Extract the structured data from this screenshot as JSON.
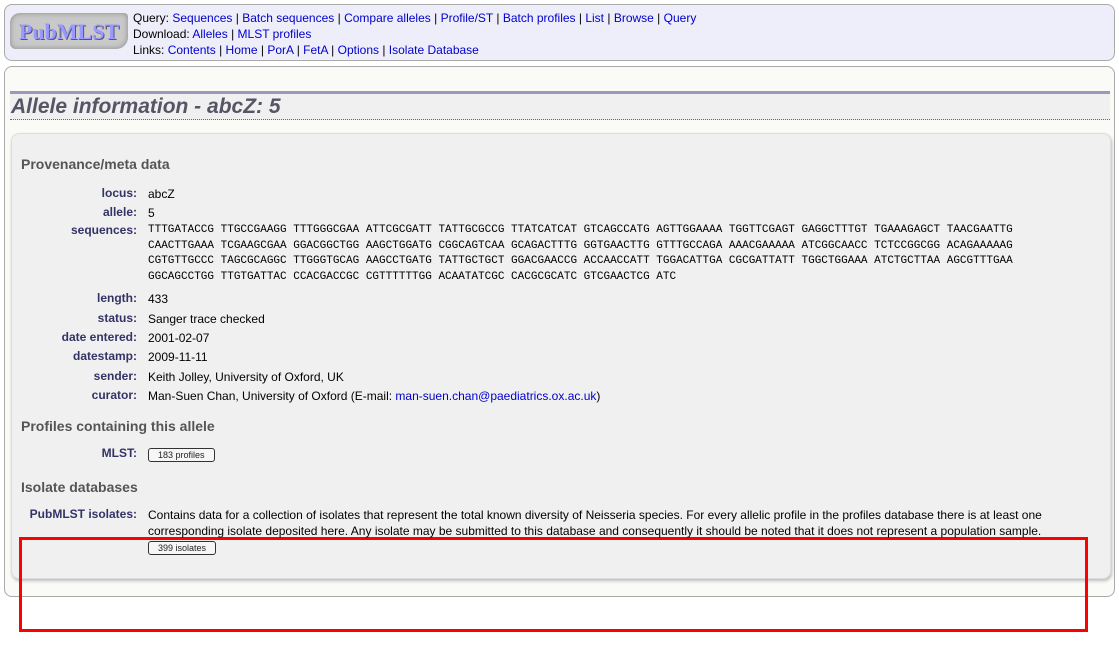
{
  "header": {
    "logo_text": "PubMLST",
    "query_label": "Query:",
    "query_links": [
      "Sequences",
      "Batch sequences",
      "Compare alleles",
      "Profile/ST",
      "Batch profiles",
      "List",
      "Browse",
      "Query"
    ],
    "download_label": "Download:",
    "download_links": [
      "Alleles",
      "MLST profiles"
    ],
    "links_label": "Links:",
    "links": [
      "Contents",
      "Home",
      "PorA",
      "FetA",
      "Options",
      "Isolate Database"
    ]
  },
  "title": "Allele information - abcZ: 5",
  "provenance": {
    "heading": "Provenance/meta data",
    "fields": [
      {
        "label": "locus:",
        "value": "abcZ"
      },
      {
        "label": "allele:",
        "value": "5"
      },
      {
        "label": "sequences:",
        "value": "TTTGATACCG TTGCCGAAGG TTTGGGCGAA ATTCGCGATT TATTGCGCCG TTATCATCAT GTCAGCCATG AGTTGGAAAA TGGTTCGAGT GAGGCTTTGT TGAAAGAGCT TAACGAATTG\nCAACTTGAAA TCGAAGCGAA GGACGGCTGG AAGCTGGATG CGGCAGTCAA GCAGACTTTG GGTGAACTTG GTTTGCCAGA AAACGAAAAA ATCGGCAACC TCTCCGGCGG ACAGAAAAAG\nCGTGTTGCCC TAGCGCAGGC TTGGGTGCAG AAGCCTGATG TATTGCTGCT GGACGAACCG ACCAACCATT TGGACATTGA CGCGATTATT TGGCTGGAAA ATCTGCTTAA AGCGTTTGAA\nGGCAGCCTGG TTGTGATTAC CCACGACCGC CGTTTTTTGG ACAATATCGC CACGCGCATC GTCGAACTCG ATC"
      },
      {
        "label": "length:",
        "value": "433"
      },
      {
        "label": "status:",
        "value": "Sanger trace checked"
      },
      {
        "label": "date entered:",
        "value": "2001-02-07"
      },
      {
        "label": "datestamp:",
        "value": "2009-11-11"
      },
      {
        "label": "sender:",
        "value": "Keith Jolley, University of Oxford, UK"
      },
      {
        "label": "curator:",
        "value": "Man-Suen Chan, University of Oxford (E-mail: ",
        "email": "man-suen.chan@paediatrics.ox.ac.uk",
        "suffix": ")"
      }
    ]
  },
  "profiles": {
    "heading": "Profiles containing this allele",
    "label": "MLST:",
    "button": "183 profiles"
  },
  "isolates": {
    "heading": "Isolate databases",
    "label": "PubMLST isolates:",
    "description": "Contains data for a collection of isolates that represent the total known diversity of Neisseria species. For every allelic profile in the profiles database there is at least one corresponding isolate deposited here. Any isolate may be submitted to this database and consequently it should be noted that it does not represent a population sample.",
    "button": "399 isolates"
  },
  "highlight_color": "#ff0000"
}
